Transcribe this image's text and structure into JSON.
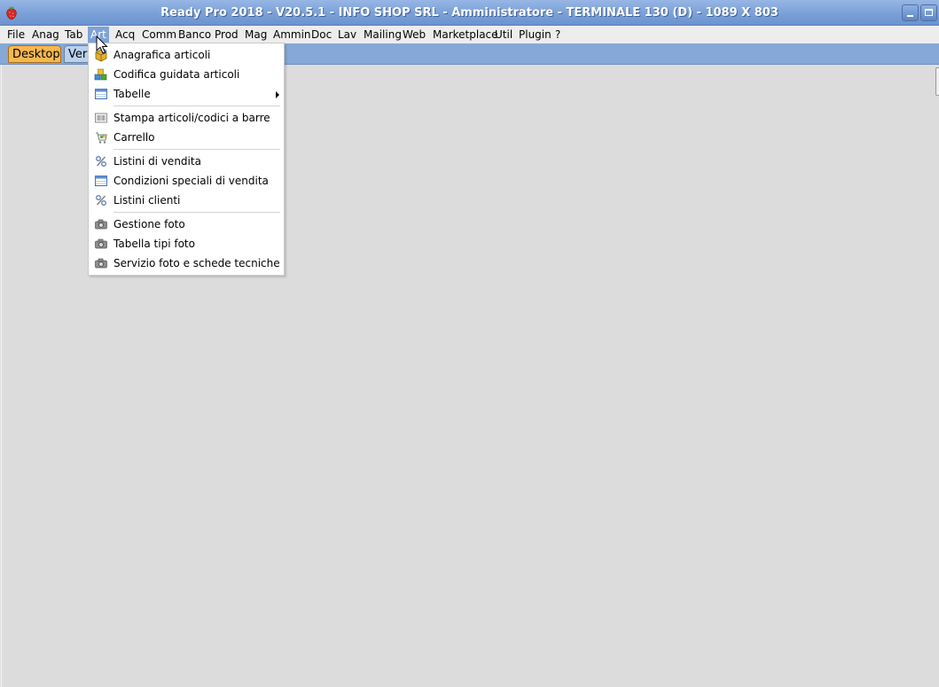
{
  "window": {
    "title": "Ready Pro 2018 - V20.5.1 - INFO SHOP SRL - Amministratore - TERMINALE 130 (D) - 1089 X 803",
    "icon": "strawberry-icon",
    "controls": [
      "minimize-icon",
      "maximize-icon"
    ]
  },
  "menubar": {
    "items": [
      {
        "label": "File"
      },
      {
        "label": "Anag"
      },
      {
        "label": "Tab"
      },
      {
        "label": "Art",
        "active": true
      },
      {
        "label": "Acq"
      },
      {
        "label": "Comm"
      },
      {
        "label": "Banco"
      },
      {
        "label": "Prod"
      },
      {
        "label": "Mag"
      },
      {
        "label": "Ammin"
      },
      {
        "label": "Doc"
      },
      {
        "label": "Lav"
      },
      {
        "label": "Mailing"
      },
      {
        "label": "Web"
      },
      {
        "label": "Marketplace"
      },
      {
        "label": "Util"
      },
      {
        "label": "Plugin"
      },
      {
        "label": "?"
      }
    ]
  },
  "tabs": [
    {
      "label": "Desktop",
      "selected": true
    },
    {
      "label": "Ver"
    }
  ],
  "dropdown": {
    "items": [
      {
        "label": "Anagrafica articoli",
        "icon": "box-icon"
      },
      {
        "label": "Codifica guidata articoli",
        "icon": "blocks-icon"
      },
      {
        "label": "Tabelle",
        "icon": "table-icon",
        "submenu": true
      },
      {
        "label": "Stampa articoli/codici a barre",
        "icon": "barcode-print-icon"
      },
      {
        "label": "Carrello",
        "icon": "cart-icon"
      },
      {
        "label": "Listini di vendita",
        "icon": "percent-icon"
      },
      {
        "label": "Condizioni speciali di vendita",
        "icon": "table-icon"
      },
      {
        "label": "Listini clienti",
        "icon": "percent-icon"
      },
      {
        "label": "Gestione foto",
        "icon": "camera-icon"
      },
      {
        "label": "Tabella tipi foto",
        "icon": "camera-icon"
      },
      {
        "label": "Servizio foto e schede tecniche",
        "icon": "camera-icon"
      }
    ]
  },
  "colors": {
    "titlebar": "#7aa0d8",
    "menu_active": "#7ea3d6",
    "tab_selected": "#f7b74f",
    "desktop_bg": "#dcdcdc"
  }
}
